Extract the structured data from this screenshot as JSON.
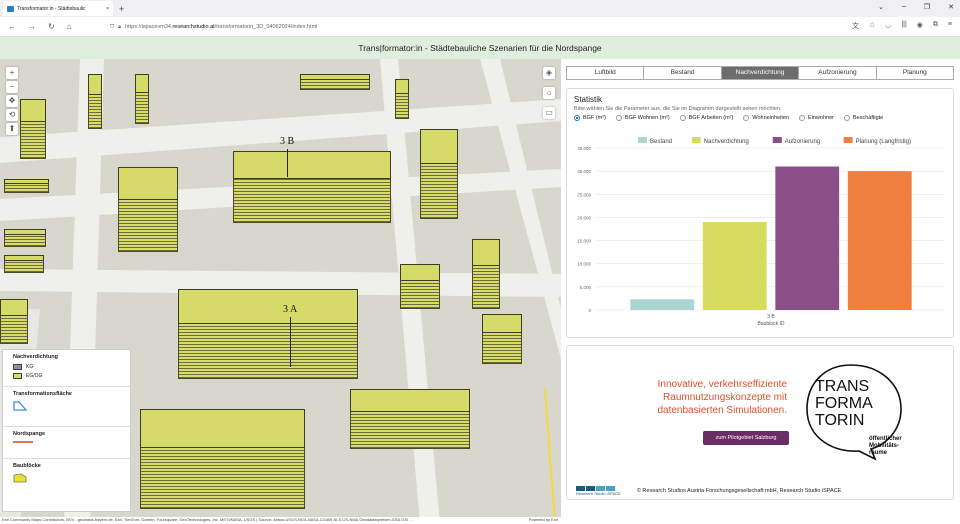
{
  "browser": {
    "tab_title": "Transformator:in - Städtebaulic",
    "url_prefix": "https://ispacevm34.",
    "url_host": "researchstudio.at",
    "url_path": "/transformatorin_3D_04062024/index.html"
  },
  "app": {
    "title": "Trans|formator:in - Städtebauliche Szenarien für die Nordspange"
  },
  "map": {
    "labels": [
      "3 B",
      "3 A"
    ],
    "attribution": "Esri Community Maps Contributors, BVV - geobasis.bayern.de, Esri, TomTom, Garmin, Foursquare, GeoTechnologies, Inc, METI/NASA, USGS | Source: Airbus,USGS,NGA,NASA,CGIAR,NLS,OS,NMA,Geodatastyrelsen,GSA,GSI ...",
    "powered": "Powered by Esri"
  },
  "legend": {
    "nachverdichtung": {
      "title": "Nachverdichtung",
      "items": [
        "KG",
        "EG/OG"
      ]
    },
    "transformation": {
      "title": "Transformationsfläche"
    },
    "nordspange": {
      "title": "Nordspange"
    },
    "baubloecke": {
      "title": "Baublöcke"
    }
  },
  "tabs": [
    "Luftbild",
    "Bestand",
    "Nachverdichtung",
    "Aufzonierung",
    "Planung"
  ],
  "active_tab": "Nachverdichtung",
  "statistik": {
    "title": "Statistik",
    "hint": "Bitte wählen Sie die Parameter aus, die Sie im Diagramm dargestellt sehen möchten.",
    "options": [
      "BGF (m²)",
      "BGF Wohnen (m²)",
      "BGF Arbeiten (m²)",
      "Wohneinheiten",
      "Einwohner",
      "Beschäftigte"
    ],
    "selected": "BGF (m²)"
  },
  "chart_data": {
    "type": "bar",
    "categories": [
      "3 B"
    ],
    "xlabel": "Baublock ID",
    "series": [
      {
        "name": "Bestand",
        "values": [
          2300
        ],
        "color": "#a9d5d3"
      },
      {
        "name": "Nachverdichtung",
        "values": [
          19000
        ],
        "color": "#d8dc5e"
      },
      {
        "name": "Aufzonierung",
        "values": [
          31000
        ],
        "color": "#8b4f87"
      },
      {
        "name": "Planung (Langfristig)",
        "values": [
          30000
        ],
        "color": "#f08040"
      }
    ],
    "yticks": [
      "0",
      "5.000",
      "10.000",
      "15.000",
      "20.000",
      "25.000",
      "30.000",
      "35.000"
    ],
    "ylim": [
      0,
      35000
    ]
  },
  "promo": {
    "line1": "Innovative, verkehrseffiziente",
    "line2": "Raumnutzungskonzepte mit",
    "line3": "datenbasierten Simulationen.",
    "button": "zum Pilotgebiet Salzburg",
    "logo_l1": "TRANS",
    "logo_l2": "FORMA",
    "logo_l3": "TORIN",
    "logo_sub1": "öffentlicher",
    "logo_sub2": "Mobilitäts-",
    "logo_sub3": "räume"
  },
  "footer": {
    "brand": "Research Studio iSPACE",
    "copyright": "© Research Studios Austria Forschungsgesellschaft mbH, Research Studio iSPACE"
  }
}
